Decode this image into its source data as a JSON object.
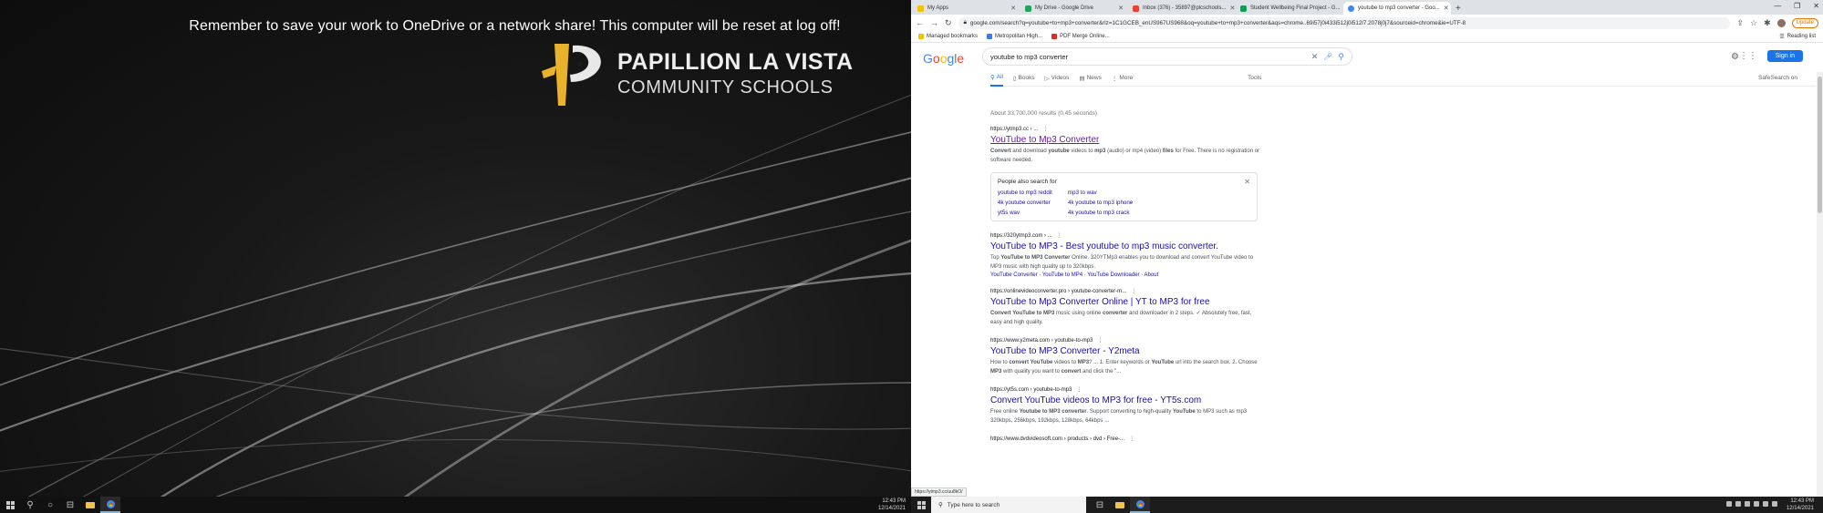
{
  "desktop": {
    "banner": "Remember to save your work to OneDrive or a network share!  This computer will be reset at log off!",
    "logo_line1": "PAPILLION LA VISTA",
    "logo_line2": "COMMUNITY SCHOOLS",
    "clock_time": "12:43 PM",
    "clock_date": "12/14/2021"
  },
  "browser": {
    "tabs": [
      {
        "label": "My Apps",
        "active": false,
        "color": "#f2c200"
      },
      {
        "label": "My Drive - Google Drive",
        "active": false,
        "color": "#1fa463"
      },
      {
        "label": "Inbox (376) - 35897@plcschools...",
        "active": false,
        "color": "#ea4335"
      },
      {
        "label": "Student Wellbeing Final Project - G...",
        "active": false,
        "color": "#0f9d58"
      },
      {
        "label": "youtube to mp3 converter - Goo...",
        "active": true,
        "color": "#4285f4"
      }
    ],
    "new_tab": "+",
    "window_controls": [
      "—",
      "❐",
      "✕"
    ],
    "omnibox_url": "google.com/search?q=youtube+to+mp3+converter&rlz=1C1GCEB_enUS967US968&oq=youtube+to+mp3+converter&aqs=chrome..69i57j0i433i512j0i512l7.2078j0j7&sourceid=chrome&ie=UTF-8",
    "update_label": "Update",
    "bookmarks": [
      "Managed bookmarks",
      "Metropolitan High...",
      "PDF Merge Online..."
    ],
    "bookmarks_right": "Reading list"
  },
  "google": {
    "query": "youtube to mp3 converter",
    "signin_label": "Sign in",
    "tabs": [
      "All",
      "Books",
      "Videos",
      "News",
      "More"
    ],
    "tools_label": "Tools",
    "safesearch_label": "SafeSearch on",
    "stats": "About 33,700,000 results (0.45 seconds)",
    "results": [
      {
        "url": "https://ytmp3.cc › ...",
        "title": "YouTube to Mp3 Converter",
        "visited": true,
        "snippet_html": "<b>Convert</b> and download <b>youtube</b> videos to <b>mp3</b> (audio) or mp4 (video) <b>files</b> for Free. There is no registration or software needed."
      },
      {
        "url": "https://320ytmp3.com › ...",
        "title": "YouTube to MP3 - Best youtube to mp3 music converter.",
        "visited": false,
        "snippet_html": "Top <b>YouTube to MP3 Converter</b> Online. 320YTMp3 enables you to download and convert YouTube video to MP3 music with high quality up to 320kbps.",
        "sitelinks": "YouTube Converter · YouTube to MP4 · YouTube Downloader · About"
      },
      {
        "url": "https://onlinevideoconverter.pro › youtube-converter-m...",
        "title": "YouTube to Mp3 Converter Online | YT to MP3 for free",
        "visited": false,
        "snippet_html": "<b>Convert YouTube to MP3</b> music using online <b>converter</b> and downloader in 2 steps. ✓ Absolutely free, fast, easy and high quality."
      },
      {
        "url": "https://www.y2meta.com › youtube-to-mp3",
        "title": "YouTube to MP3 Converter - Y2meta",
        "visited": false,
        "snippet_html": "How to <b>convert YouTube</b> videos to <b>MP3</b>? ... 1. Enter keywords or <b>YouTube</b> url into the search box. 2. Choose <b>MP3</b> with quality you want to <b>convert</b> and click the \"..."
      },
      {
        "url": "https://yt5s.com › youtube-to-mp3",
        "title": "Convert YouTube videos to MP3 for free - YT5s.com",
        "visited": false,
        "snippet_html": "Free online <b>Youtube to MP3 converter</b>. Support converting to high-quality <b>YouTube</b> to MP3 such as mp3 320kbps, 256kbps, 192kbps, 128kbps, 64kbps ..."
      },
      {
        "url": "https://www.dvdvideosoft.com › products › dvd › Free-...",
        "title": "",
        "visited": false,
        "snippet_html": ""
      }
    ],
    "people_also_search": {
      "title": "People also search for",
      "items": [
        "youtube to mp3 reddit",
        "mp3 to wav",
        "4k youtube converter",
        "4k youtube to mp3 iphone",
        "yt5s wav",
        "4k youtube to mp3 crack"
      ]
    }
  },
  "status_bar_url": "https://ytmp3.cc/uu8kO/",
  "taskbar": {
    "search_placeholder": "Type here to search",
    "clock_time": "12:43 PM",
    "clock_date": "12/14/2021"
  }
}
